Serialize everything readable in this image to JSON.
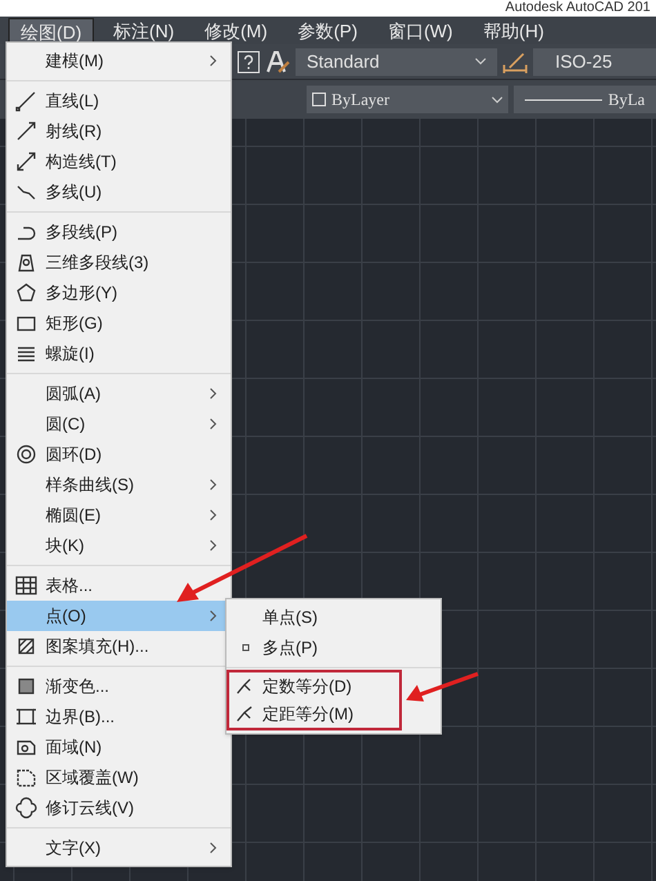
{
  "window": {
    "title": "Autodesk AutoCAD 201"
  },
  "menubar": [
    {
      "label": "绘图(D)",
      "selected": true
    },
    {
      "label": "标注(N)",
      "selected": false
    },
    {
      "label": "修改(M)",
      "selected": false
    },
    {
      "label": "参数(P)",
      "selected": false
    },
    {
      "label": "窗口(W)",
      "selected": false
    },
    {
      "label": "帮助(H)",
      "selected": false
    }
  ],
  "toolbar": {
    "text_style": "Standard",
    "dim_style": "ISO-25",
    "color_control": "ByLayer",
    "linetype": "ByLa"
  },
  "menu": {
    "groups": [
      [
        {
          "label": "建模(M)",
          "submenu": true,
          "selected": false
        }
      ],
      [
        {
          "label": "直线(L)",
          "submenu": false,
          "selected": false
        },
        {
          "label": "射线(R)",
          "submenu": false,
          "selected": false
        },
        {
          "label": "构造线(T)",
          "submenu": false,
          "selected": false
        },
        {
          "label": "多线(U)",
          "submenu": false,
          "selected": false
        }
      ],
      [
        {
          "label": "多段线(P)",
          "submenu": false,
          "selected": false
        },
        {
          "label": "三维多段线(3)",
          "submenu": false,
          "selected": false
        },
        {
          "label": "多边形(Y)",
          "submenu": false,
          "selected": false
        },
        {
          "label": "矩形(G)",
          "submenu": false,
          "selected": false
        },
        {
          "label": "螺旋(I)",
          "submenu": false,
          "selected": false
        }
      ],
      [
        {
          "label": "圆弧(A)",
          "submenu": true,
          "selected": false
        },
        {
          "label": "圆(C)",
          "submenu": true,
          "selected": false
        },
        {
          "label": "圆环(D)",
          "submenu": false,
          "selected": false
        },
        {
          "label": "样条曲线(S)",
          "submenu": true,
          "selected": false
        },
        {
          "label": "椭圆(E)",
          "submenu": true,
          "selected": false
        },
        {
          "label": "块(K)",
          "submenu": true,
          "selected": false
        }
      ],
      [
        {
          "label": "表格...",
          "submenu": false,
          "selected": false
        },
        {
          "label": "点(O)",
          "submenu": true,
          "selected": true
        },
        {
          "label": "图案填充(H)...",
          "submenu": false,
          "selected": false
        }
      ],
      [
        {
          "label": "渐变色...",
          "submenu": false,
          "selected": false
        },
        {
          "label": "边界(B)...",
          "submenu": false,
          "selected": false
        },
        {
          "label": "面域(N)",
          "submenu": false,
          "selected": false
        },
        {
          "label": "区域覆盖(W)",
          "submenu": false,
          "selected": false
        },
        {
          "label": "修订云线(V)",
          "submenu": false,
          "selected": false
        }
      ],
      [
        {
          "label": "文字(X)",
          "submenu": true,
          "selected": false
        }
      ]
    ]
  },
  "submenu": {
    "groups": [
      [
        {
          "label": "单点(S)",
          "highlighted": false
        },
        {
          "label": "多点(P)",
          "highlighted": false
        }
      ],
      [
        {
          "label": "定数等分(D)",
          "highlighted": true
        },
        {
          "label": "定距等分(M)",
          "highlighted": true
        }
      ]
    ]
  }
}
